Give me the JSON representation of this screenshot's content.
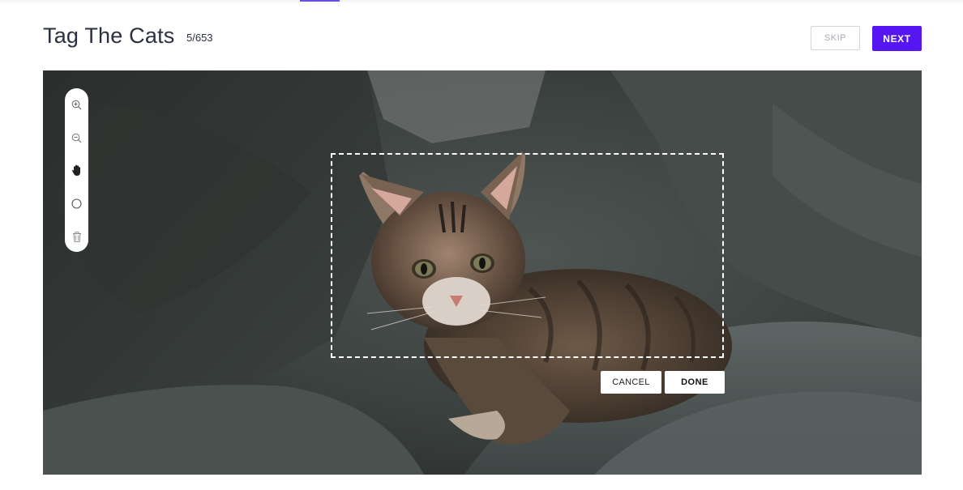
{
  "header": {
    "title": "Tag The Cats",
    "counter": "5/653",
    "skip_label": "SKIP",
    "next_label": "NEXT"
  },
  "toolbar": {
    "tools": [
      "zoom-in-icon",
      "zoom-out-icon",
      "hand-icon",
      "circle-icon",
      "trash-icon"
    ]
  },
  "selection": {
    "cancel_label": "CANCEL",
    "done_label": "DONE"
  },
  "colors": {
    "accent": "#5516f2",
    "tab_indicator": "#6a4fe0",
    "title_text": "#2b3040"
  }
}
